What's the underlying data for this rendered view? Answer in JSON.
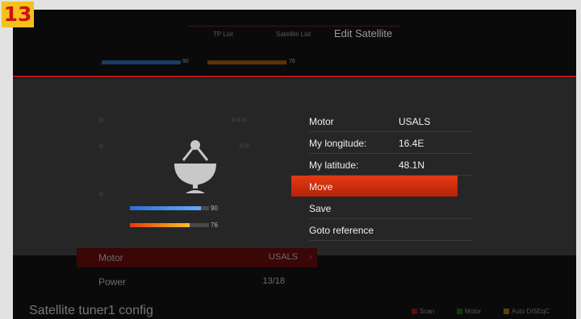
{
  "step_badge": "13",
  "header": {
    "tabs": [
      "TP List",
      "Satellite List",
      "Edit Satellite"
    ]
  },
  "bg_signal": {
    "strength_label": "90",
    "quality_label": "76",
    "strength": 0.9,
    "quality": 0.76
  },
  "dialog": {
    "signal": {
      "strength_label": "90",
      "quality_label": "76",
      "strength": 0.9,
      "quality": 0.76
    },
    "menu": [
      {
        "label": "Motor",
        "value": "USALS"
      },
      {
        "label": "My longitude:",
        "value": "16.4E"
      },
      {
        "label": "My latitude:",
        "value": "48.1N"
      },
      {
        "label": "Move",
        "value": ""
      },
      {
        "label": "Save",
        "value": ""
      },
      {
        "label": "Goto reference",
        "value": ""
      }
    ],
    "selected_index": 3
  },
  "settings": {
    "motor": {
      "label": "Motor",
      "value": "USALS"
    },
    "power": {
      "label": "Power",
      "value": "13/18"
    }
  },
  "footer": {
    "title": "Satellite tuner1 config",
    "keys": [
      {
        "label": "Scan",
        "color": "#c01414"
      },
      {
        "label": "Motor",
        "color": "#1e8a1e"
      },
      {
        "label": "Auto DiSEqC",
        "color": "#d8a21a"
      }
    ]
  },
  "colors": {
    "accent": "#d42a0a",
    "signal_blue": "#3a85ee",
    "signal_orange": "#f0a020"
  }
}
